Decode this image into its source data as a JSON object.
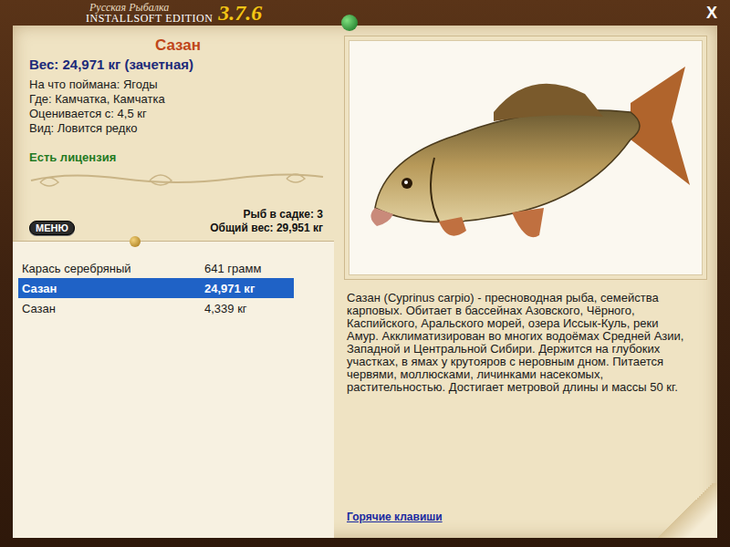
{
  "window": {
    "title_line1": "Русская Рыбалка",
    "title_line2": "INSTALLSOFT EDITION",
    "version": "3.7.6",
    "close": "X"
  },
  "fish": {
    "name": "Сазан",
    "weight": "Вес: 24,971 кг (зачетная)",
    "details": [
      "На что поймана: Ягоды",
      "Где: Камчатка, Камчатка",
      "Оценивается с: 4,5 кг",
      "Вид: Ловится редко"
    ],
    "license": "Есть лицензия",
    "description": "Сазан (Cyprinus carpio) - пресноводная рыба, семейства карповых. Обитает в бассейнах Азовского, Чёрного, Каспийского, Аральского морей, озера Иссык-Куль, реки Амур. Акклиматизирован во многих водоёмах Средней Азии, Западной и Центральной Сибири. Держится на глубоких участках, в ямах у крутояров с неровным дном. Питается червями, моллюсками, личинками насекомых, растительностью. Достигает метровой длины и массы 50 кг."
  },
  "menu_button": "МЕНЮ",
  "keepnet": {
    "count": "Рыб в садке: 3",
    "total": "Общий вес: 29,951 кг"
  },
  "catch_list": [
    {
      "name": "Карась серебряный",
      "weight": "641 грамм",
      "selected": false
    },
    {
      "name": "Сазан",
      "weight": "24,971 кг",
      "selected": true
    },
    {
      "name": "Сазан",
      "weight": "4,339 кг",
      "selected": false
    }
  ],
  "hotkeys_link": "Горячие клавиши"
}
